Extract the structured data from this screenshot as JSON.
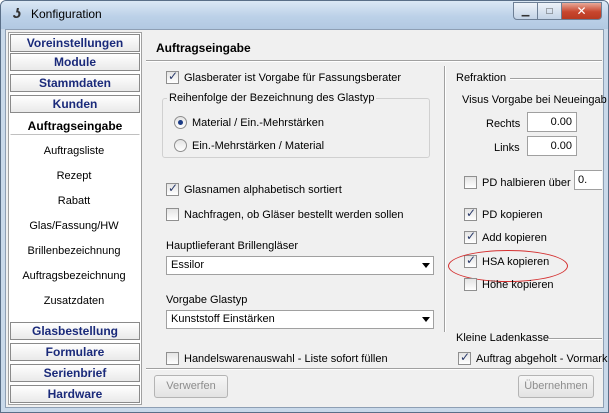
{
  "window": {
    "title": "Konfiguration"
  },
  "sidebar": {
    "categories_top": [
      {
        "label": "Voreinstellungen"
      },
      {
        "label": "Module"
      },
      {
        "label": "Stammdaten"
      },
      {
        "label": "Kunden"
      }
    ],
    "active_category": "Auftragseingabe",
    "items": [
      "Auftragsliste",
      "Rezept",
      "Rabatt",
      "Glas/Fassung/HW",
      "Brillenbezeichnung",
      "Auftragsbezeichnung",
      "Zusatzdaten"
    ],
    "categories_bottom": [
      {
        "label": "Glasbestellung"
      },
      {
        "label": "Formulare"
      },
      {
        "label": "Serienbrief"
      },
      {
        "label": "Hardware"
      }
    ]
  },
  "content": {
    "title": "Auftragseingabe",
    "cb_glasberater": {
      "label": "Glasberater ist Vorgabe für Fassungsberater",
      "checked": true
    },
    "order_group": {
      "legend": "Reihenfolge der Bezeichnung des Glastyp",
      "opt1": "Material / Ein.-Mehrstärken",
      "opt2": "Ein.-Mehrstärken / Material"
    },
    "cb_sortiert": {
      "label": "Glasnamen alphabetisch sortiert",
      "checked": true
    },
    "cb_nachfragen": {
      "label": "Nachfragen, ob Gläser bestellt werden sollen",
      "checked": false
    },
    "haupt_label": "Hauptlieferant Brillengläser",
    "haupt_value": "Essilor",
    "glastyp_label": "Vorgabe Glastyp",
    "glastyp_value": "Kunststoff Einstärken",
    "cb_handel": {
      "label": "Handelswarenauswahl - Liste sofort füllen",
      "checked": false
    },
    "refraktion": {
      "legend": "Refraktion",
      "visus_label": "Visus Vorgabe bei Neueingab",
      "rechts_label": "Rechts",
      "rechts_value": "0.00",
      "links_label": "Links",
      "links_value": "0.00",
      "pd_halb": {
        "label": "PD halbieren über",
        "value": "0."
      },
      "pd_kop": {
        "label": "PD kopieren"
      },
      "add_kop": {
        "label": "Add kopieren"
      },
      "hsa_kop": {
        "label": "HSA kopieren"
      },
      "hoehe_kop": {
        "label": "Höhe kopieren"
      }
    },
    "ladenkasse": {
      "legend": "Kleine Ladenkasse",
      "cb_auftrag": {
        "label": "Auftrag abgeholt - Vormarki"
      }
    }
  },
  "buttons": {
    "verwerfen": "Verwerfen",
    "uebernehmen": "Übernehmen"
  },
  "colors": {
    "category_text": "#1a2a7a",
    "highlight_ellipse": "#d43030"
  }
}
